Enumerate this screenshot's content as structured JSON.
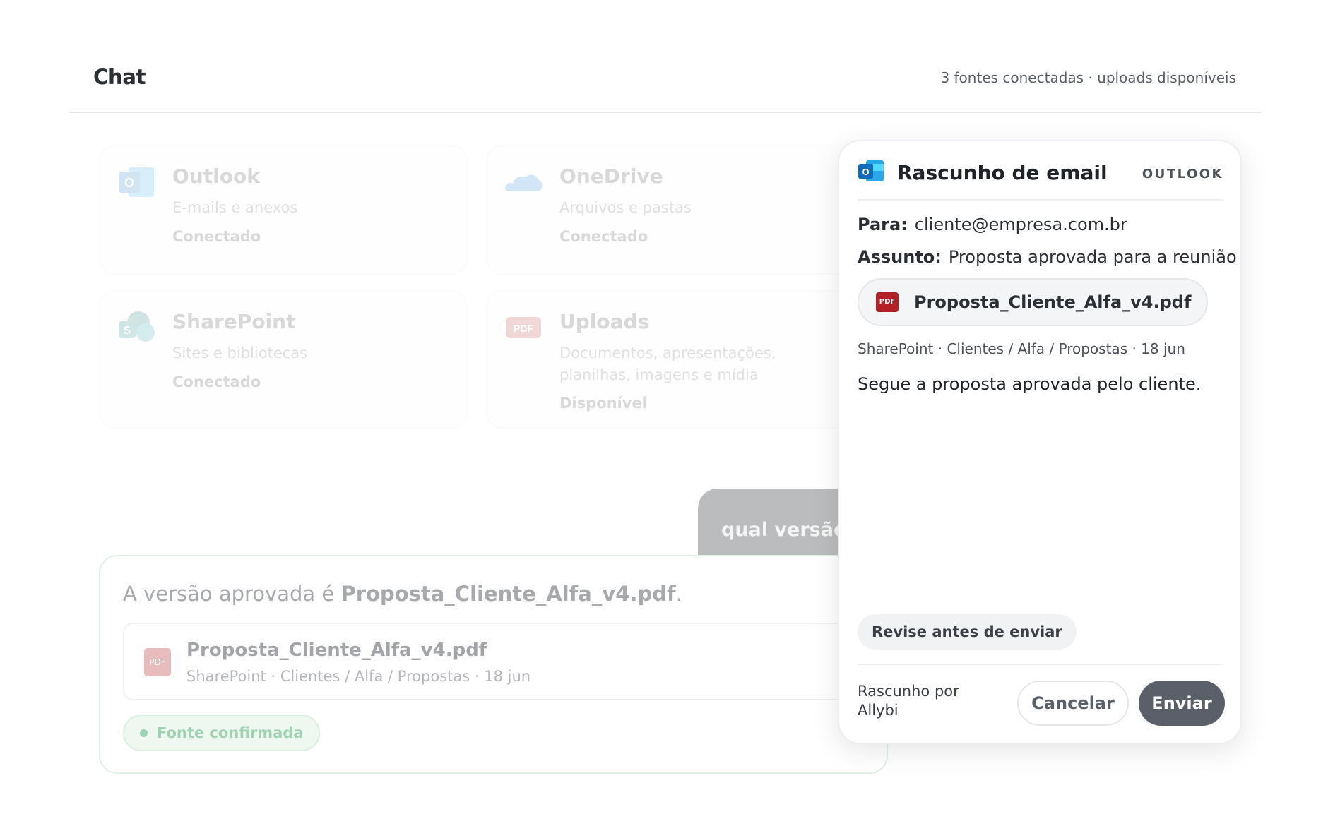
{
  "header": {
    "title": "Chat",
    "status": "3 fontes conectadas · uploads disponíveis"
  },
  "sources": [
    {
      "name": "Outlook",
      "description": "E-mails e anexos",
      "status": "Conectado",
      "icon": "outlook-icon"
    },
    {
      "name": "OneDrive",
      "description": "Arquivos e pastas",
      "status": "Conectado",
      "icon": "onedrive-icon"
    },
    {
      "name": "SharePoint",
      "description": "Sites e bibliotecas",
      "status": "Conectado",
      "icon": "sharepoint-icon"
    },
    {
      "name": "Uploads",
      "description": "Documentos, apresentações, planilhas, imagens e mídia",
      "status": "Disponível",
      "icon": "pdf-icon"
    }
  ],
  "chat": {
    "user_message": "qual versão p",
    "answer_prefix": "A versão aprovada é ",
    "answer_file": "Proposta_Cliente_Alfa_v4.pdf",
    "answer_suffix": ".",
    "file": {
      "name": "Proposta_Cliente_Alfa_v4.pdf",
      "path": "SharePoint · Clientes / Alfa / Propostas · 18 jun",
      "type_label": "PDF"
    },
    "confirmation": "Fonte confirmada"
  },
  "email_draft": {
    "title": "Rascunho de email",
    "brand": "OUTLOOK",
    "to_label": "Para:",
    "to_value": "cliente@empresa.com.br",
    "subject_label": "Assunto:",
    "subject_value": "Proposta aprovada para a reunião",
    "attachment_name": "Proposta_Cliente_Alfa_v4.pdf",
    "attachment_type": "PDF",
    "attachment_path": "SharePoint · Clientes / Alfa / Propostas · 18 jun",
    "body": "Segue a proposta aprovada pelo cliente.",
    "review_hint": "Revise antes de enviar",
    "footer_label": "Rascunho por Allybi",
    "cancel_label": "Cancelar",
    "send_label": "Enviar"
  },
  "colors": {
    "send_button": "#5b5f6a",
    "pdf_red": "#b32025",
    "confirm_green": "#9fd2b1",
    "outlook_blue": "#0f6cbd"
  }
}
